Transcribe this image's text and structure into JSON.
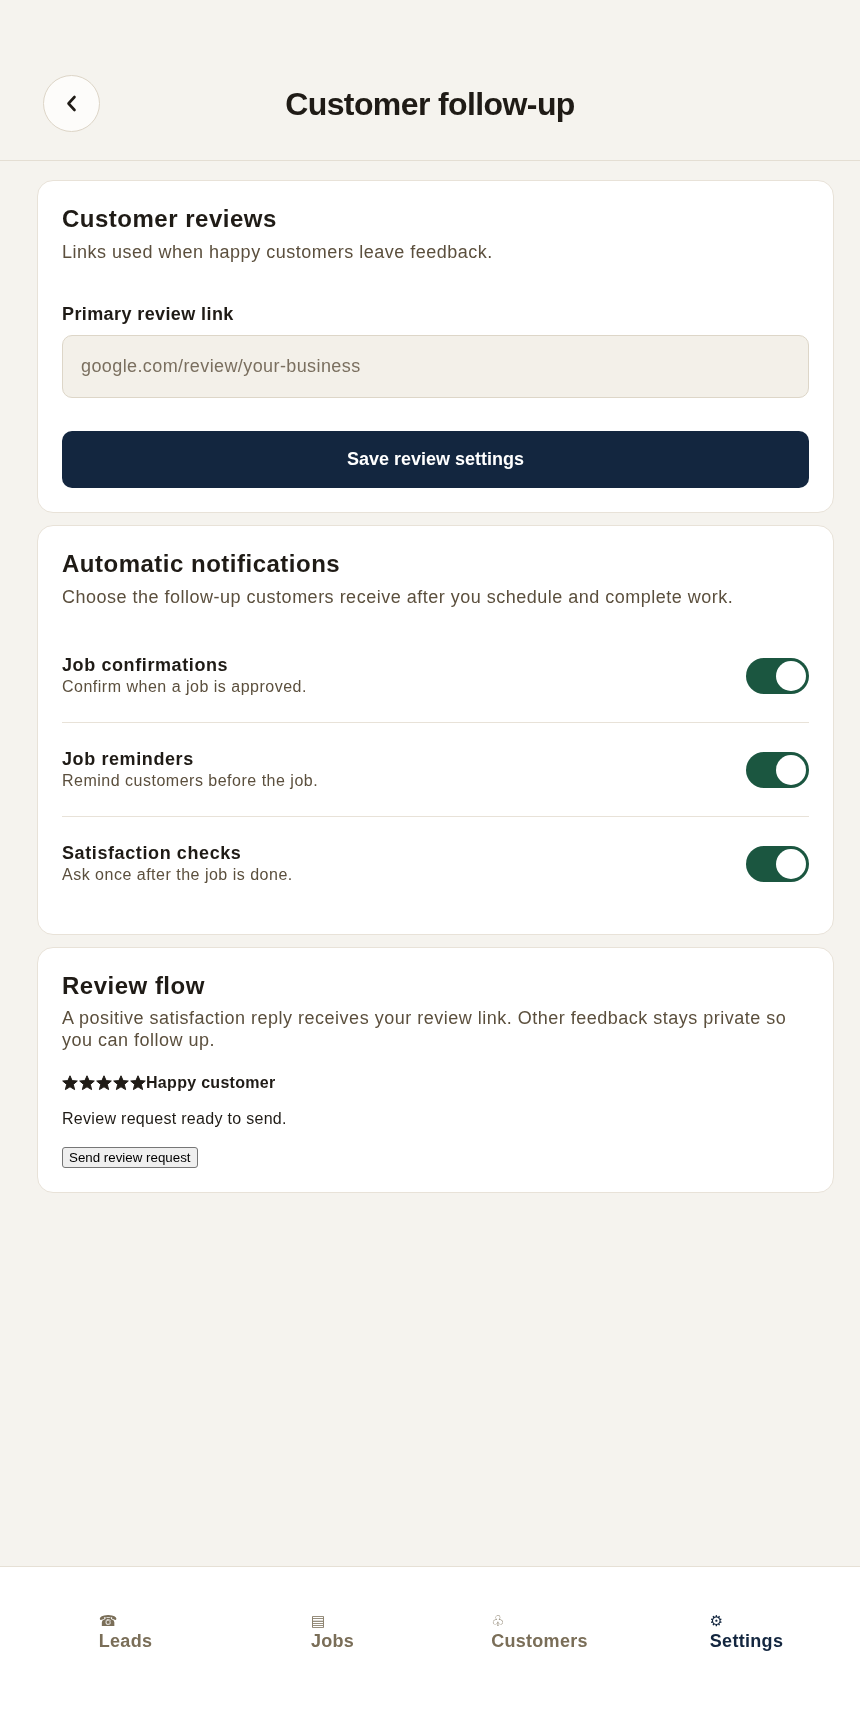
{
  "header": {
    "title": "Customer follow-up"
  },
  "customer_reviews": {
    "title": "Customer reviews",
    "description": "Links used when happy customers leave feedback.",
    "field": {
      "label": "Primary review link",
      "placeholder": "google.com/review/your-business"
    },
    "button": "Save review settings"
  },
  "automatic_notifications": {
    "title": "Automatic notifications",
    "description": "Choose the follow-up customers receive after you schedule and complete work.",
    "items": [
      {
        "title": "Job confirmations",
        "description": "Confirm when a job is approved.",
        "on": true
      },
      {
        "title": "Job reminders",
        "description": "Remind customers before the job.",
        "on": true
      },
      {
        "title": "Satisfaction checks",
        "description": "Ask once after the job is done.",
        "on": true
      }
    ]
  },
  "review_flow": {
    "title": "Review flow",
    "description": "A positive satisfaction reply receives your review link. Other feedback stays private so you can follow up.",
    "rating": {
      "stars": 5,
      "label": "Happy customer"
    },
    "status": "Review request ready to send.",
    "button": "Send review request"
  },
  "bottom_nav": [
    {
      "icon": "☎",
      "label": "Leads",
      "selected": false
    },
    {
      "icon": "▤",
      "label": "Jobs",
      "selected": false
    },
    {
      "icon": "♧",
      "label": "Customers",
      "selected": false
    },
    {
      "icon": "⚙",
      "label": "Settings",
      "selected": true
    }
  ]
}
